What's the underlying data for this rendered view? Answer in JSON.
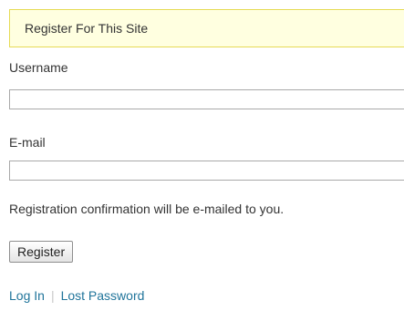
{
  "notice": {
    "text": "Register For This Site"
  },
  "form": {
    "username_label": "Username",
    "username_value": "",
    "email_label": "E-mail",
    "email_value": "",
    "message": "Registration confirmation will be e-mailed to you.",
    "submit_label": "Register"
  },
  "links": {
    "login": "Log In",
    "separator": "|",
    "lost_password": "Lost Password"
  },
  "colors": {
    "notice_background": "#ffffe0",
    "notice_border": "#e6db55",
    "link": "#21759b",
    "text": "#333333"
  }
}
